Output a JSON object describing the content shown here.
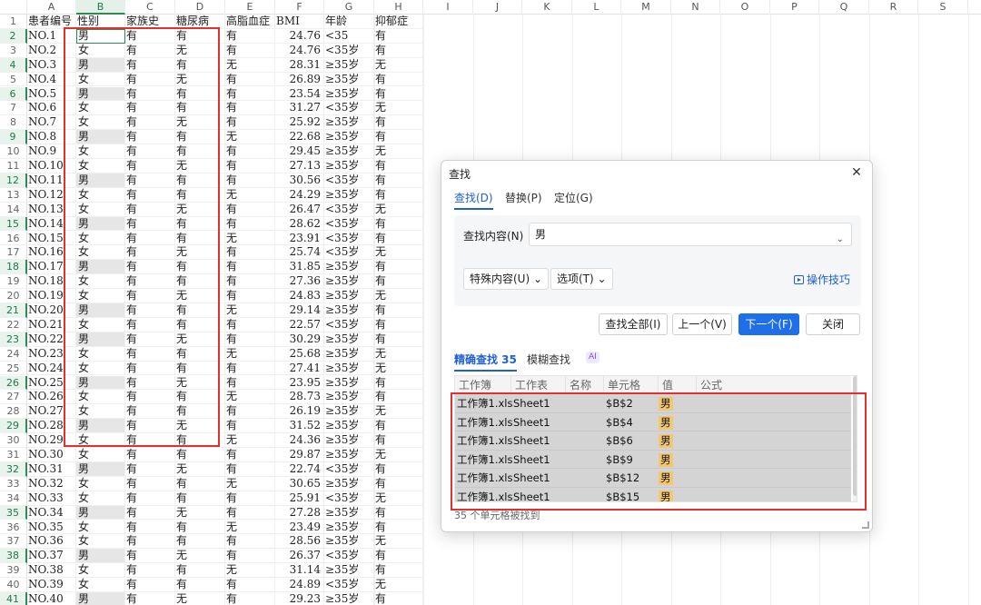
{
  "sheet": {
    "columns": [
      "A",
      "B",
      "C",
      "D",
      "E",
      "F",
      "G",
      "H",
      "I",
      "J",
      "K",
      "L",
      "M",
      "N",
      "O",
      "P",
      "Q",
      "R",
      "S"
    ],
    "header_row": [
      "患者编号",
      "性别",
      "家族史",
      "糖尿病",
      "高脂血症",
      "BMI",
      "年龄",
      "抑郁症"
    ],
    "rows": [
      [
        "NO.1",
        "男",
        "有",
        "有",
        "有",
        "24.76",
        "<35",
        "有"
      ],
      [
        "NO.2",
        "女",
        "有",
        "无",
        "有",
        "24.76",
        "<35岁",
        "有"
      ],
      [
        "NO.3",
        "男",
        "有",
        "有",
        "无",
        "28.31",
        "≥35岁",
        "无"
      ],
      [
        "NO.4",
        "女",
        "有",
        "无",
        "有",
        "26.89",
        "≥35岁",
        "有"
      ],
      [
        "NO.5",
        "男",
        "有",
        "有",
        "有",
        "23.54",
        "≥35岁",
        "有"
      ],
      [
        "NO.6",
        "女",
        "有",
        "有",
        "有",
        "31.27",
        "<35岁",
        "无"
      ],
      [
        "NO.7",
        "女",
        "有",
        "无",
        "有",
        "25.92",
        "≥35岁",
        "有"
      ],
      [
        "NO.8",
        "男",
        "有",
        "有",
        "无",
        "22.68",
        "≥35岁",
        "有"
      ],
      [
        "NO.9",
        "女",
        "有",
        "有",
        "有",
        "29.45",
        "≥35岁",
        "无"
      ],
      [
        "NO.10",
        "女",
        "有",
        "无",
        "有",
        "27.13",
        "≥35岁",
        "有"
      ],
      [
        "NO.11",
        "男",
        "有",
        "有",
        "有",
        "30.56",
        "<35岁",
        "有"
      ],
      [
        "NO.12",
        "女",
        "有",
        "有",
        "无",
        "24.29",
        "≥35岁",
        "有"
      ],
      [
        "NO.13",
        "女",
        "有",
        "无",
        "有",
        "26.47",
        "<35岁",
        "无"
      ],
      [
        "NO.14",
        "男",
        "有",
        "有",
        "有",
        "28.62",
        "<35岁",
        "有"
      ],
      [
        "NO.15",
        "女",
        "有",
        "有",
        "无",
        "23.91",
        "<35岁",
        "有"
      ],
      [
        "NO.16",
        "女",
        "有",
        "无",
        "有",
        "25.74",
        "<35岁",
        "无"
      ],
      [
        "NO.17",
        "男",
        "有",
        "有",
        "有",
        "31.85",
        "≥35岁",
        "有"
      ],
      [
        "NO.18",
        "女",
        "有",
        "有",
        "有",
        "27.36",
        "≥35岁",
        "有"
      ],
      [
        "NO.19",
        "女",
        "有",
        "无",
        "有",
        "24.83",
        "≥35岁",
        "无"
      ],
      [
        "NO.20",
        "男",
        "有",
        "有",
        "无",
        "29.14",
        "≥35岁",
        "有"
      ],
      [
        "NO.21",
        "女",
        "有",
        "有",
        "有",
        "22.57",
        "<35岁",
        "有"
      ],
      [
        "NO.22",
        "男",
        "有",
        "无",
        "有",
        "30.29",
        "≥35岁",
        "有"
      ],
      [
        "NO.23",
        "女",
        "有",
        "有",
        "无",
        "25.68",
        "≥35岁",
        "无"
      ],
      [
        "NO.24",
        "女",
        "有",
        "有",
        "有",
        "27.41",
        "≥35岁",
        "无"
      ],
      [
        "NO.25",
        "男",
        "有",
        "无",
        "有",
        "23.95",
        "≥35岁",
        "有"
      ],
      [
        "NO.26",
        "女",
        "有",
        "有",
        "无",
        "28.73",
        "≥35岁",
        "有"
      ],
      [
        "NO.27",
        "女",
        "有",
        "有",
        "有",
        "26.19",
        "≥35岁",
        "无"
      ],
      [
        "NO.28",
        "男",
        "有",
        "无",
        "有",
        "31.52",
        "≥35岁",
        "有"
      ],
      [
        "NO.29",
        "女",
        "有",
        "有",
        "无",
        "24.36",
        "≥35岁",
        "有"
      ],
      [
        "NO.30",
        "女",
        "有",
        "有",
        "有",
        "29.87",
        "≥35岁",
        "无"
      ],
      [
        "NO.31",
        "男",
        "有",
        "无",
        "有",
        "22.74",
        "<35岁",
        "有"
      ],
      [
        "NO.32",
        "女",
        "有",
        "有",
        "无",
        "30.65",
        "≥35岁",
        "有"
      ],
      [
        "NO.33",
        "女",
        "有",
        "有",
        "有",
        "25.91",
        "<35岁",
        "无"
      ],
      [
        "NO.34",
        "男",
        "有",
        "无",
        "有",
        "27.28",
        "≥35岁",
        "有"
      ],
      [
        "NO.35",
        "女",
        "有",
        "有",
        "无",
        "23.49",
        "≥35岁",
        "有"
      ],
      [
        "NO.36",
        "女",
        "有",
        "有",
        "有",
        "28.56",
        "≥35岁",
        "无"
      ],
      [
        "NO.37",
        "男",
        "有",
        "无",
        "有",
        "26.37",
        "<35岁",
        "有"
      ],
      [
        "NO.38",
        "女",
        "有",
        "有",
        "无",
        "31.14",
        "≥35岁",
        "有"
      ],
      [
        "NO.39",
        "女",
        "有",
        "有",
        "有",
        "24.89",
        "<35岁",
        "无"
      ],
      [
        "NO.40",
        "男",
        "有",
        "无",
        "有",
        "29.23",
        "≥35岁",
        "有"
      ]
    ]
  },
  "dialog": {
    "title": "查找",
    "close_symbol": "✕",
    "tabs": [
      "查找(D)",
      "替换(P)",
      "定位(G)"
    ],
    "find_label": "查找内容(N)",
    "find_value": "男",
    "special_button": "特殊内容(U) ⌄",
    "options_button": "选项(T) ⌄",
    "tips_link": "操作技巧",
    "buttons": {
      "find_all": "查找全部(I)",
      "prev": "上一个(V)",
      "next": "下一个(F)",
      "close": "关闭"
    },
    "mode_tabs": {
      "exact": "精确查找 35",
      "fuzzy": "模糊查找",
      "ai": "AI"
    },
    "result_headers": [
      "工作簿",
      "工作表",
      "名称",
      "单元格",
      "值",
      "公式"
    ],
    "results": [
      {
        "book": "工作簿1.xls",
        "sheet": "Sheet1",
        "cell": "$B$2",
        "value": "男"
      },
      {
        "book": "工作簿1.xls",
        "sheet": "Sheet1",
        "cell": "$B$4",
        "value": "男"
      },
      {
        "book": "工作簿1.xls",
        "sheet": "Sheet1",
        "cell": "$B$6",
        "value": "男"
      },
      {
        "book": "工作簿1.xls",
        "sheet": "Sheet1",
        "cell": "$B$9",
        "value": "男"
      },
      {
        "book": "工作簿1.xls",
        "sheet": "Sheet1",
        "cell": "$B$12",
        "value": "男"
      },
      {
        "book": "工作簿1.xls",
        "sheet": "Sheet1",
        "cell": "$B$15",
        "value": "男"
      }
    ],
    "status": "35 个单元格被找到"
  }
}
